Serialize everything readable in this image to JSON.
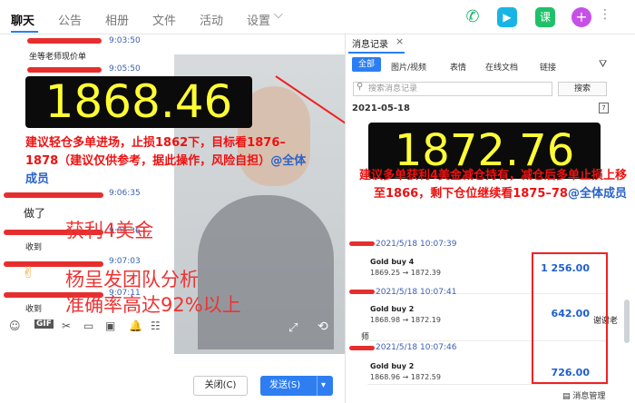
{
  "topbar": {
    "tabs": [
      "聊天",
      "公告",
      "相册",
      "文件",
      "活动",
      "设置"
    ],
    "settings_chevron": "⌵",
    "icons": [
      "phone-icon",
      "video-icon",
      "course-icon",
      "add-app-icon"
    ],
    "course_label": "课",
    "add_label": "+"
  },
  "chat": {
    "messages": [
      {
        "time": "9:03:50",
        "text": "坐等老师现价单"
      },
      {
        "time": "9:05:50"
      },
      {
        "big_price": "1868.46"
      },
      {
        "advice": "建议轻仓多单进场，止损1862下，目标看1876–1878（建议仅供参考，据此操作，风险自担）",
        "mention": "@全体成员"
      },
      {
        "time": "9:06:35",
        "text": "做了"
      },
      {
        "time": "9:06:36",
        "overlay": "获利4美金",
        "text": "收到"
      },
      {
        "time": "9:07:03",
        "overlay": "杨呈发团队分析"
      },
      {
        "time": "9:07:11",
        "overlay": "准确率高达92%以上",
        "text": "收到"
      }
    ],
    "emoji_thumb": "✌",
    "tools": [
      "☺",
      "GIF",
      "✂",
      "▭",
      "▣",
      "🔔",
      "☷",
      "⌚"
    ]
  },
  "buttons": {
    "close": "关闭(C)",
    "send": "发送(S)",
    "send_arrow": "▾"
  },
  "right": {
    "title": "消息记录",
    "close": "×",
    "tabs": [
      "全部",
      "图片/视频",
      "表情",
      "在线文档",
      "链接"
    ],
    "filter_icon": "⛛",
    "search_placeholder": "搜索消息记录",
    "search_button": "搜索",
    "date": "2021-05-18",
    "calendar": "7",
    "big_price": "1872.76",
    "advice": "建议多单获利4美金减仓持有，减仓后多单止损上移至1866，剩下仓位继续看1875–78",
    "mention": "@全体成员",
    "trades": [
      {
        "time": "2021/5/18 10:07:39",
        "label": "Gold buy 4",
        "prices": "1869.25 → 1872.39",
        "amount": "1 256.00"
      },
      {
        "time": "2021/5/18 10:07:41",
        "label": "Gold buy 2",
        "prices": "1868.98 → 1872.19",
        "amount": "642.00"
      },
      {
        "time": "2021/5/18 10:07:46",
        "label": "Gold buy 2",
        "prices": "1868.96 → 1872.59",
        "amount": "726.00"
      }
    ],
    "thanks": "谢谢老",
    "teacher_fragment": "师",
    "manage": "消息管理"
  }
}
